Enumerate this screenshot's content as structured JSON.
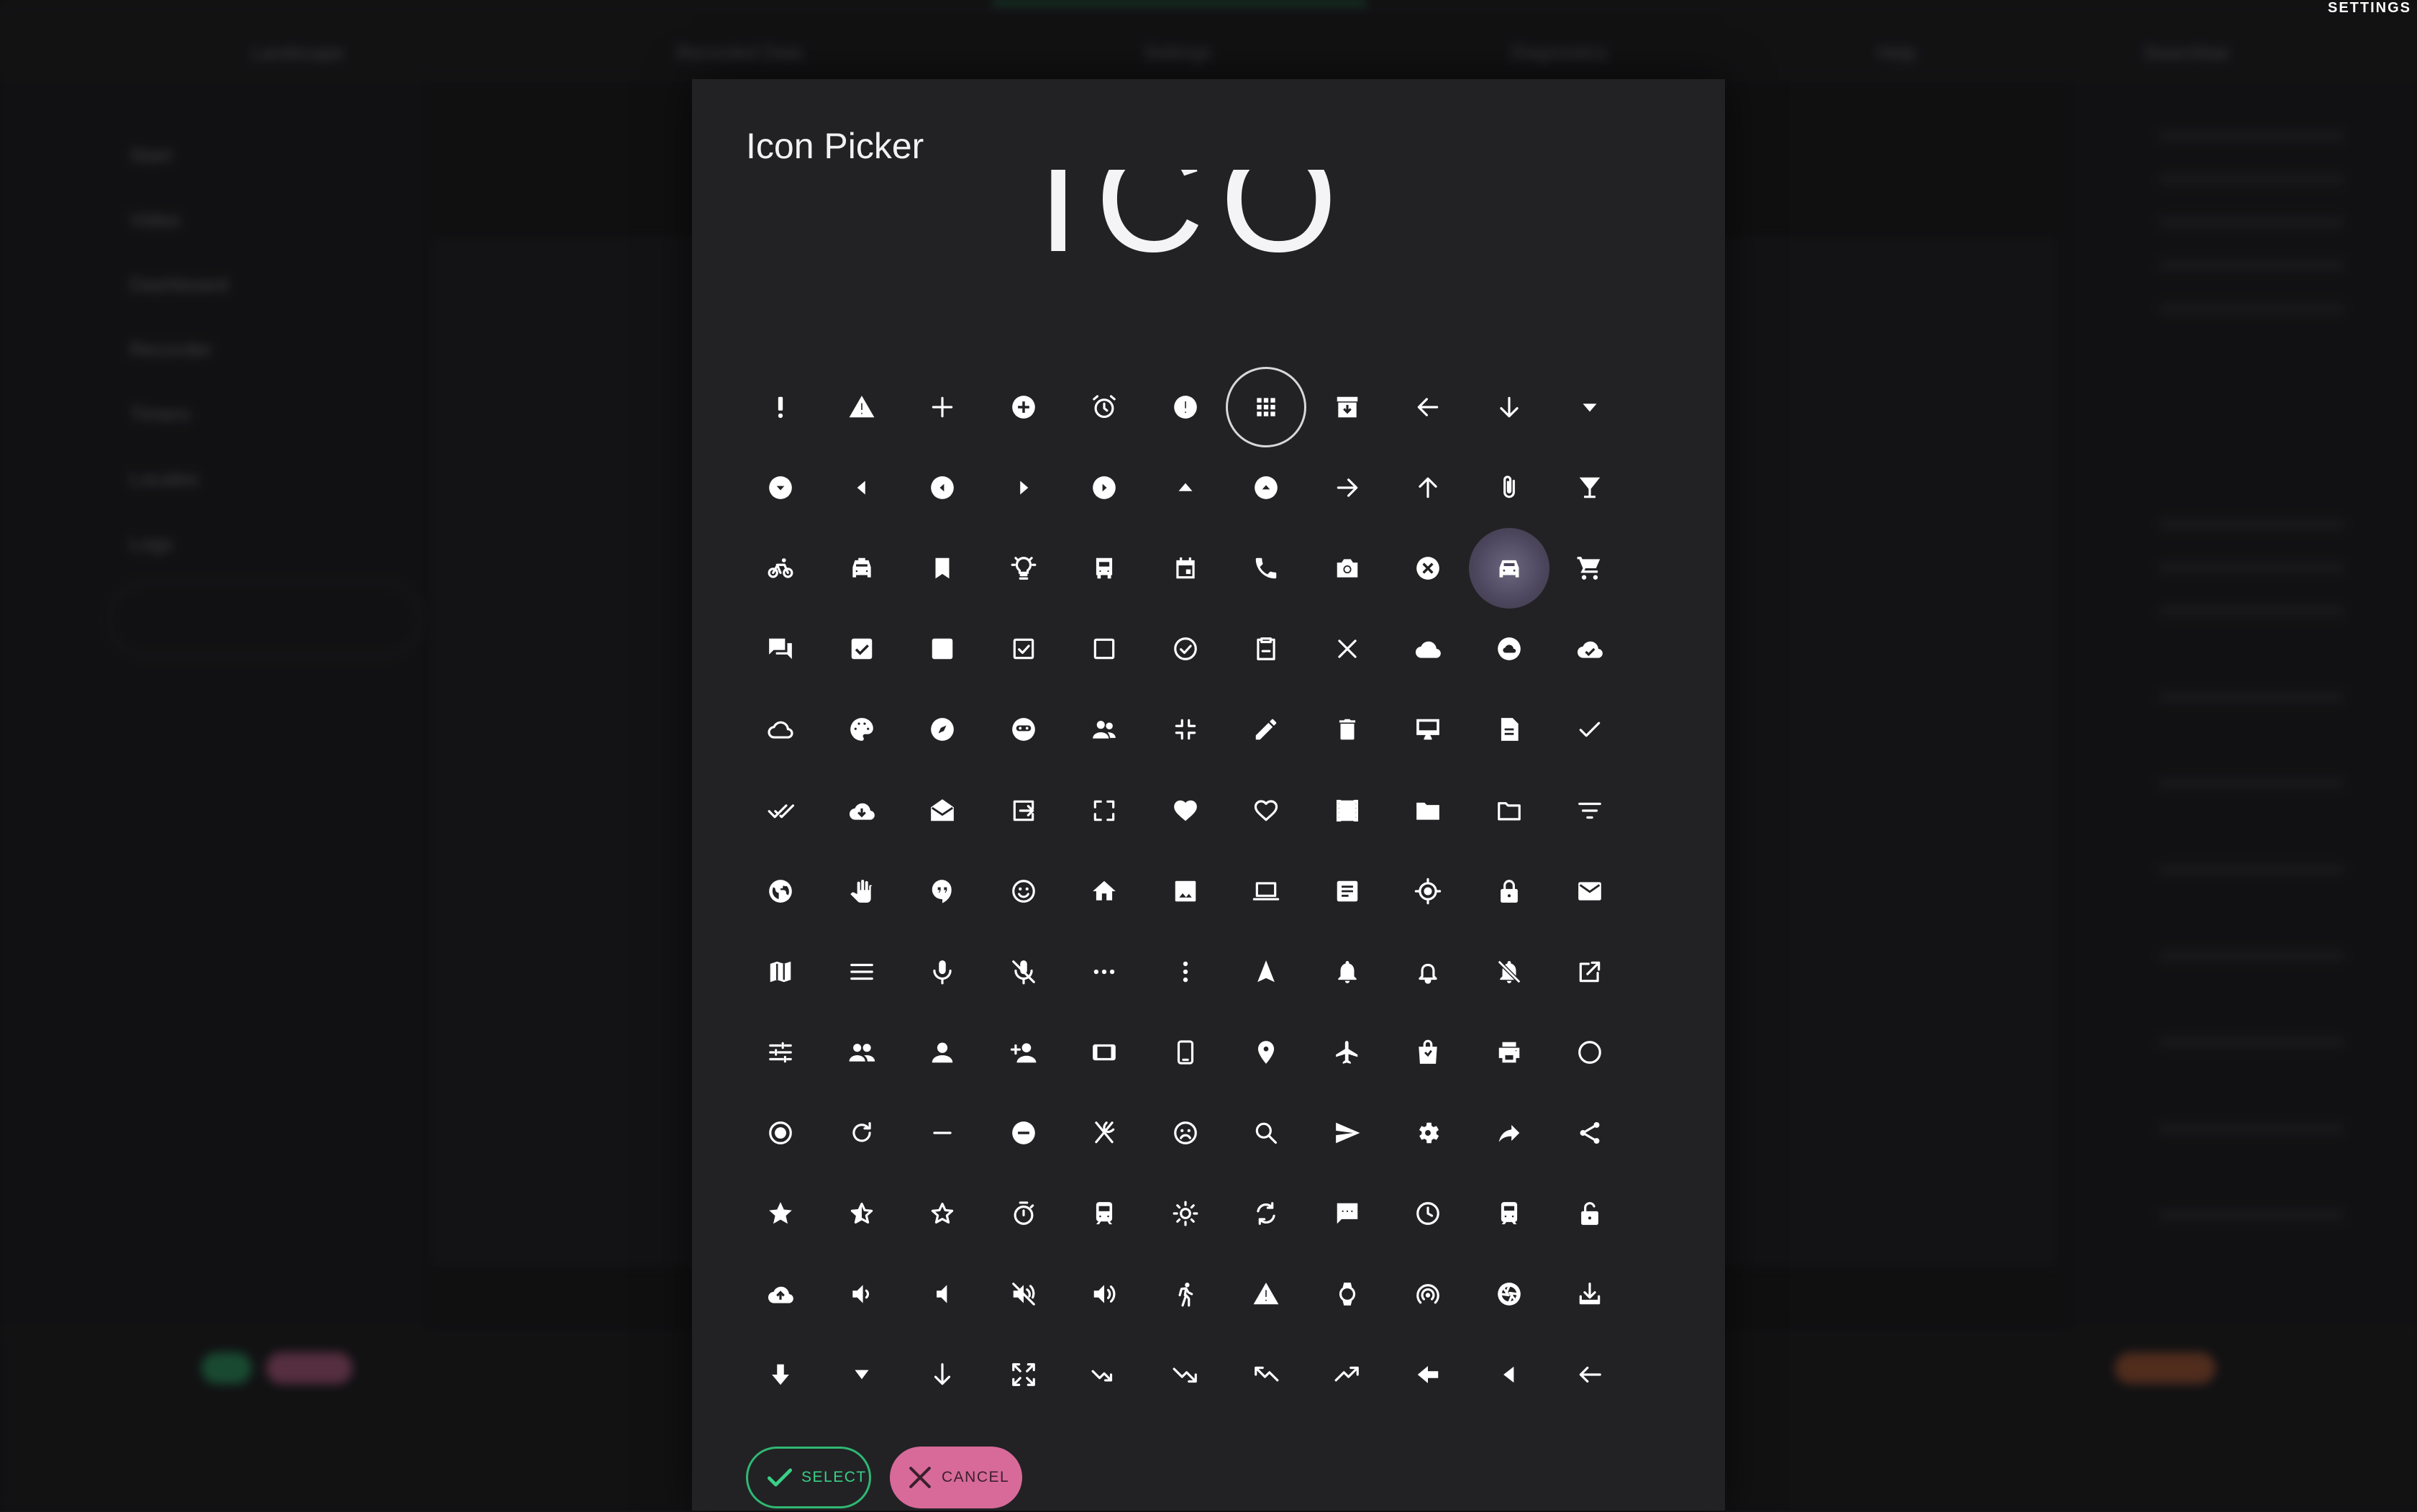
{
  "settings_label": "SETTINGS",
  "dialog": {
    "title": "Icon Picker",
    "logo_text": "ICON",
    "select_label": "SELECT",
    "cancel_label": "CANCEL"
  },
  "colors": {
    "accent_green": "#2fb872",
    "cancel_pink": "#d86a9a",
    "dialog_bg": "#222225"
  },
  "icons": [
    "priority-high",
    "warning",
    "add",
    "add-circle",
    "alarm",
    "error",
    "apps",
    "archive",
    "arrow-back",
    "arrow-downward",
    "arrow-drop-down",
    "arrow-drop-down-circle",
    "arrow-left",
    "arrow-left-circle",
    "arrow-right",
    "arrow-right-circle",
    "arrow-drop-up",
    "arrow-drop-up-circle",
    "arrow-forward",
    "arrow-upward",
    "attach-file",
    "local-bar",
    "directions-bike",
    "local-taxi",
    "bookmark",
    "lightbulb",
    "directions-bus",
    "event",
    "call",
    "photo-camera",
    "cancel",
    "directions-car",
    "shopping-cart",
    "chat",
    "check-box",
    "check-box-filled",
    "check-box-outline",
    "check-box-outline-blank",
    "check-circle-outline",
    "content-paste",
    "close",
    "cloud",
    "cloud-circle",
    "cloud-done",
    "cloud-outline",
    "palette",
    "explore",
    "face",
    "supervisor-account",
    "fullscreen-exit",
    "create",
    "delete",
    "desktop-mac",
    "description",
    "done",
    "done-all",
    "cloud-download",
    "drafts",
    "exit-to-app",
    "fullscreen",
    "favorite",
    "favorite-border",
    "local-movies",
    "folder",
    "folder-open",
    "filter-list",
    "public",
    "pan-tool",
    "hangout",
    "insert-emoticon",
    "home",
    "image",
    "laptop",
    "library-books",
    "my-location",
    "lock",
    "mail",
    "map",
    "menu",
    "mic",
    "mic-off",
    "more-horiz",
    "more-vert",
    "navigation",
    "notifications",
    "notifications-none",
    "notifications-off",
    "open-in-new",
    "tune",
    "people",
    "person",
    "person-add",
    "crop-landscape",
    "phone-android",
    "place",
    "flight",
    "local-mall",
    "print",
    "radio-button-unchecked",
    "radio-button-checked",
    "refresh",
    "remove",
    "remove-circle",
    "restaurant",
    "sentiment-dissatisfied",
    "search",
    "send",
    "settings",
    "reply",
    "share",
    "star",
    "star-half",
    "star-border",
    "timer",
    "directions-subway",
    "wb-sunny",
    "sync",
    "sms",
    "schedule",
    "train",
    "lock-open",
    "backup",
    "volume-down",
    "volume-mute",
    "volume-off",
    "volume-up",
    "directions-walk",
    "report-problem",
    "watch",
    "wifi-tethering",
    "camera",
    "system-update-alt",
    "arrow-downward-bold",
    "arrow-drop-down-small",
    "south",
    "zoom-out-map",
    "trending-flat-down",
    "trending-down",
    "trending-up-left",
    "trending-up",
    "arrow-back-bold",
    "arrow-left-small",
    "west"
  ],
  "selected_index": 6,
  "hover_index": 31,
  "background": {
    "top_links": [
      "Landscape",
      "Recorded Data",
      "Settings",
      "Diagnostics",
      "Help",
      "Searchbar"
    ],
    "nav_items": [
      "Start",
      "Video",
      "Dashboard",
      "Recorder",
      "Timers",
      "Locales",
      "Logs"
    ]
  }
}
